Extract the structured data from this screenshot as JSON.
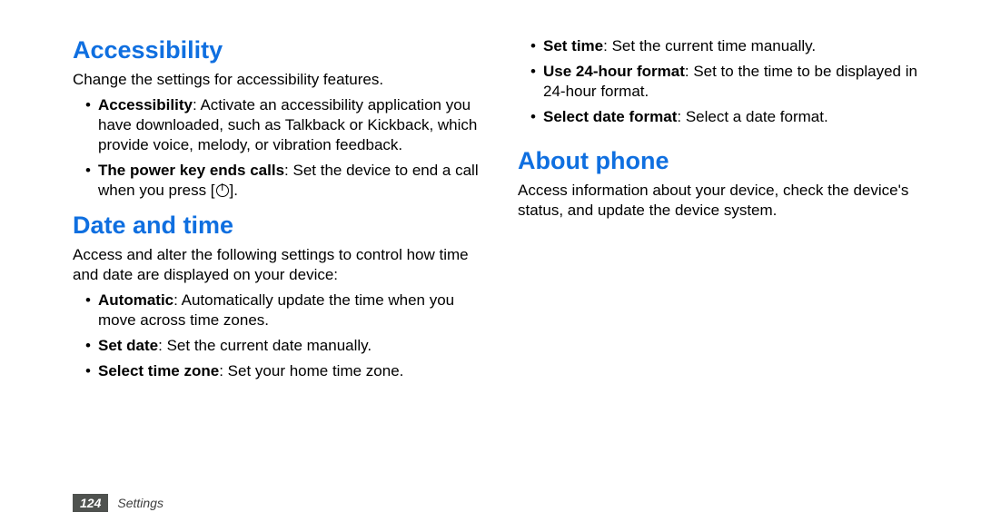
{
  "left": {
    "h1": "Accessibility",
    "p1": "Change the settings for accessibility features.",
    "b1_bold": "Accessibility",
    "b1_rest": ": Activate an accessibility application you have downloaded, such as Talkback or Kickback, which provide voice, melody, or vibration feedback.",
    "b2_bold": "The power key ends calls",
    "b2_rest_a": ": Set the device to end a call when you press [",
    "b2_rest_b": "].",
    "h2": "Date and time",
    "p2": "Access and alter the following settings to control how time and date are displayed on your device:",
    "b3_bold": "Automatic",
    "b3_rest": ": Automatically update the time when you move across time zones.",
    "b4_bold": "Set date",
    "b4_rest": ": Set the current date manually.",
    "b5_bold": "Select time zone",
    "b5_rest": ": Set your home time zone."
  },
  "right": {
    "b1_bold": "Set time",
    "b1_rest": ": Set the current time manually.",
    "b2_bold": "Use 24-hour format",
    "b2_rest": ": Set to the time to be displayed in 24-hour format.",
    "b3_bold": "Select date format",
    "b3_rest": ": Select a date format.",
    "h1": "About phone",
    "p1": "Access information about your device, check the device's status, and update the device system."
  },
  "footer": {
    "page": "124",
    "chapter": "Settings"
  }
}
